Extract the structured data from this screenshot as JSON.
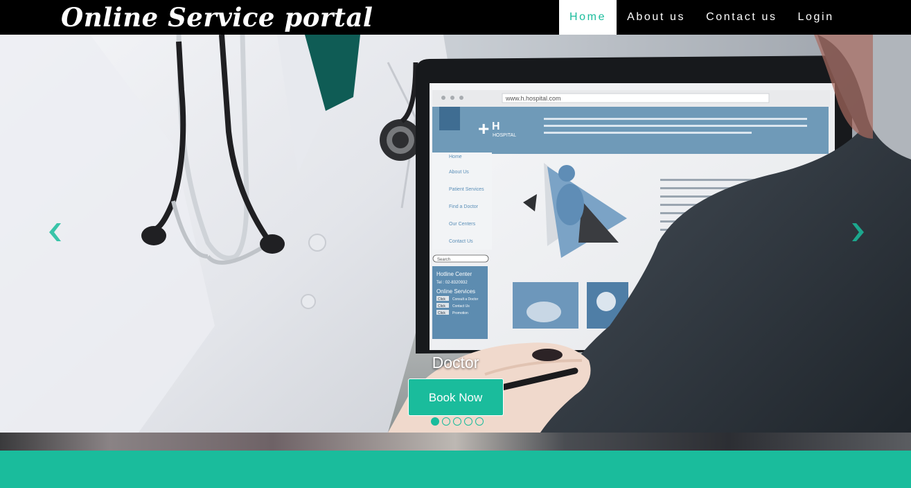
{
  "brand": {
    "title": "Online Service portal"
  },
  "nav": {
    "items": [
      {
        "label": "Home",
        "active": true
      },
      {
        "label": "About us",
        "active": false
      },
      {
        "label": "Contact us",
        "active": false
      },
      {
        "label": "Login",
        "active": false
      }
    ]
  },
  "carousel": {
    "caption_title": "Doctor",
    "button_label": "Book Now",
    "slide_count": 5,
    "active_slide": 1,
    "prev_icon": "chevron-left-icon",
    "next_icon": "chevron-right-icon",
    "image": {
      "subject": "doctor showing hospital website on laptop",
      "laptop_screen": {
        "url_text": "www.h.hospital.com",
        "logo_text": "H",
        "logo_sub": "HOSPITAL",
        "menu": [
          "Home",
          "About Us",
          "Patient Services",
          "Find a Doctor",
          "Our Centers",
          "Contact Us"
        ],
        "search_label": "Search",
        "hotline_title": "Hotline Center",
        "hotline_tel": "Tel : 02-8320932",
        "services_title": "Online Services",
        "service_click": "Click",
        "services": [
          "Consult a Doctor",
          "Contact Us",
          "Promotion"
        ]
      }
    }
  },
  "colors": {
    "accent": "#1abc9c",
    "navbar_bg": "#000000",
    "text_light": "#ffffff"
  }
}
